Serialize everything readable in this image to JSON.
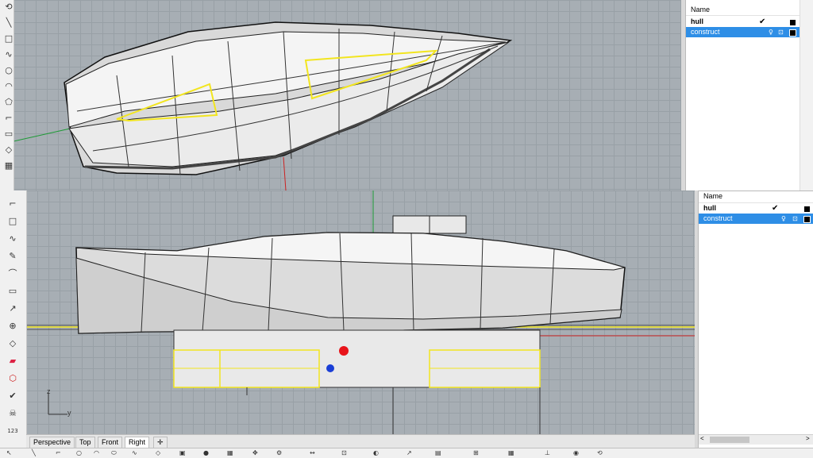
{
  "layers_top": {
    "column_header": "Name",
    "rows": [
      {
        "name": "hull",
        "check": "✔",
        "selected": false
      },
      {
        "name": "construct",
        "check": "",
        "selected": true
      }
    ]
  },
  "layers_bottom": {
    "column_header": "Name",
    "rows": [
      {
        "name": "hull",
        "check": "✔",
        "selected": false
      },
      {
        "name": "construct",
        "check": "",
        "selected": true
      }
    ]
  },
  "viewport_tabs": [
    "Perspective",
    "Top",
    "Front",
    "Right"
  ],
  "active_tab": "Right",
  "add_tab_symbol": "✛",
  "axis_labels": {
    "z": "z",
    "y": "y"
  },
  "scroll_arrows": {
    "left": "<",
    "right": ">"
  },
  "colors": {
    "accent": "#2e8ee6",
    "selection": "#f2e51f",
    "viewport": "#a7aeb4"
  },
  "left_toolbar_icons": [
    "rotate-icon",
    "line-icon",
    "rectangle-icon",
    "curve-icon",
    "circle-icon",
    "arc-icon",
    "polygon-icon",
    "text-icon",
    "fillet-icon",
    "extrude-icon",
    "surface-icon",
    "mesh-icon",
    "layer-icon",
    "render-icon",
    "solid-icon",
    "check-icon",
    "gumball-icon",
    "numbers-icon"
  ]
}
